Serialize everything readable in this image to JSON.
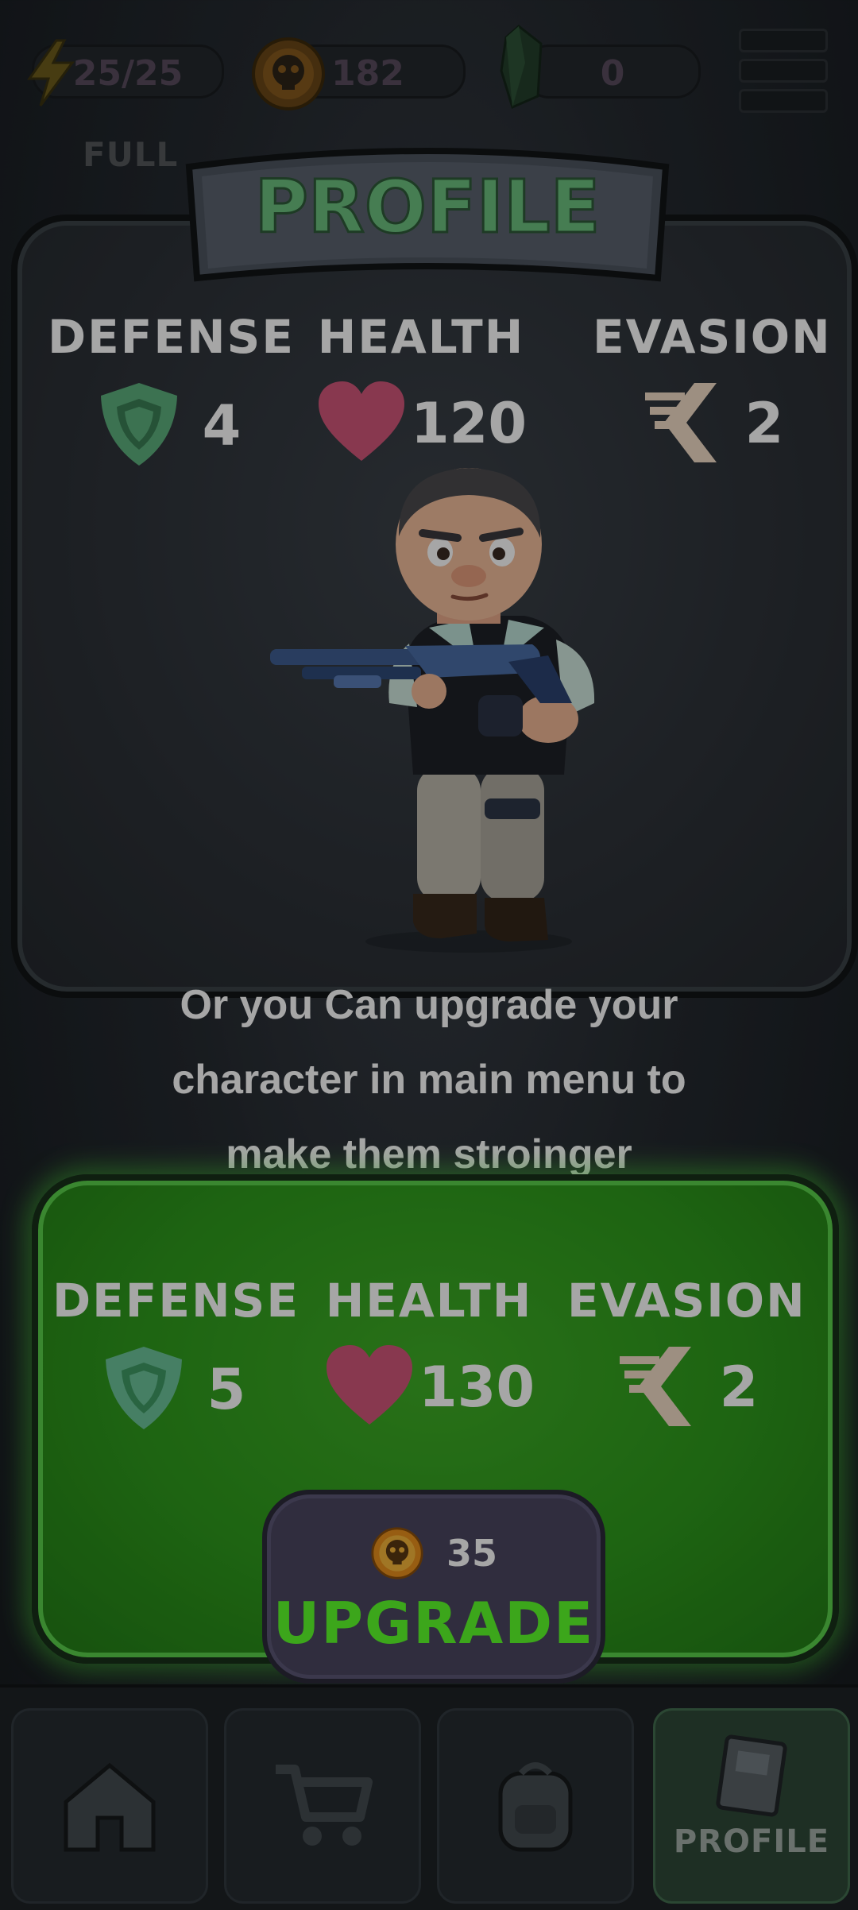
{
  "topbar": {
    "energy": "25/25",
    "energy_status": "FULL",
    "coins": "182",
    "gems": "0"
  },
  "profile": {
    "title": "PROFILE",
    "stats": [
      {
        "label": "DEFENSE",
        "value": "4",
        "icon": "shield-icon"
      },
      {
        "label": "HEALTH",
        "value": "120",
        "icon": "heart-icon"
      },
      {
        "label": "EVASION",
        "value": "2",
        "icon": "evasion-icon"
      }
    ]
  },
  "hint": {
    "line1": "Or you Can upgrade your",
    "line2": "character in main menu to",
    "line3": "make them stroinger"
  },
  "upgrade": {
    "stats": [
      {
        "label": "DEFENSE",
        "value": "5",
        "icon": "shield-icon"
      },
      {
        "label": "HEALTH",
        "value": "130",
        "icon": "heart-icon"
      },
      {
        "label": "EVASION",
        "value": "2",
        "icon": "evasion-icon"
      }
    ],
    "cost": "35",
    "button_label": "UPGRADE"
  },
  "nav": {
    "items": [
      {
        "icon": "home-icon"
      },
      {
        "icon": "shop-cart-icon"
      },
      {
        "icon": "backpack-icon"
      },
      {
        "icon": "profile-icon",
        "label": "PROFILE",
        "active": true
      }
    ]
  },
  "colors": {
    "upgrade_green": "#3fae26",
    "upgrade_text": "#5cff2a",
    "title_green": "#6cc07f",
    "heart_pink": "#d2567a"
  }
}
